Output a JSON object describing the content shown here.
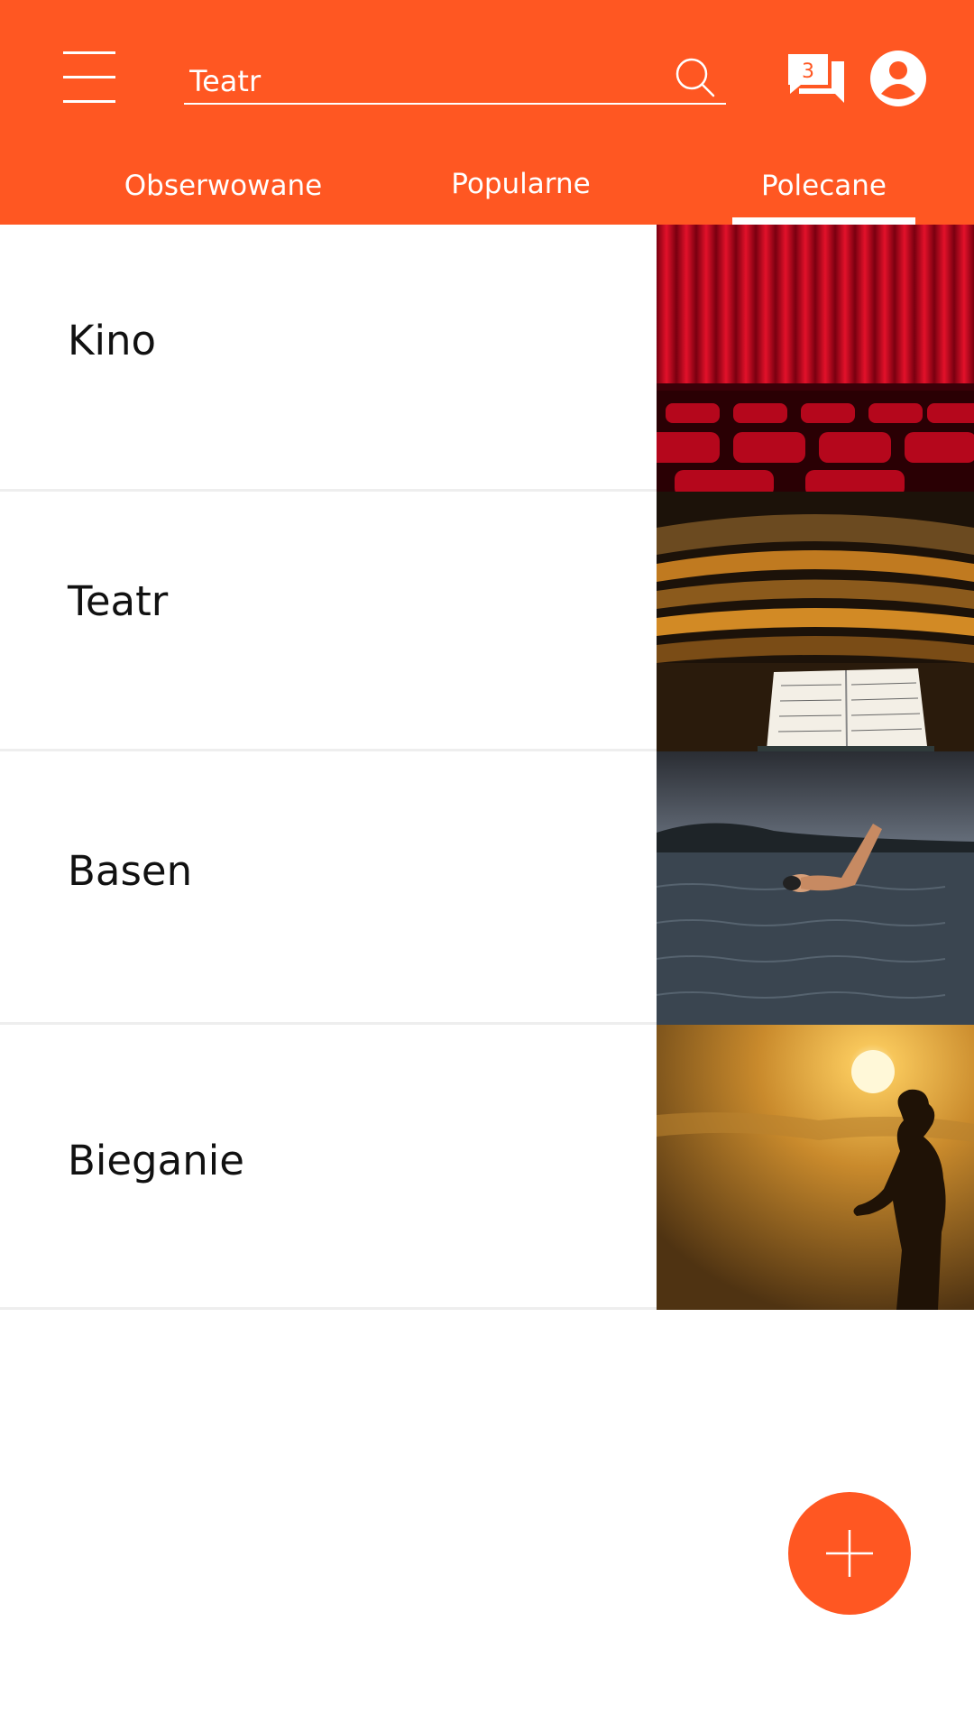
{
  "colors": {
    "accent": "#FF5722",
    "text": "#111111",
    "divider": "#eeeeee"
  },
  "header": {
    "menu_icon": "hamburger-menu-icon",
    "search": {
      "value": "Teatr",
      "placeholder": "",
      "icon": "search-icon"
    },
    "messages": {
      "icon": "chat-icon",
      "badge": "3"
    },
    "profile_icon": "avatar-icon"
  },
  "tabs": [
    {
      "label": "Obserwowane",
      "active": false
    },
    {
      "label": "Popularne",
      "active": false
    },
    {
      "label": "Polecane",
      "active": true
    }
  ],
  "items": [
    {
      "label": "Kino",
      "image": "theater-curtain-seats"
    },
    {
      "label": "Teatr",
      "image": "concert-hall-sheet-music"
    },
    {
      "label": "Basen",
      "image": "swimmer-in-water"
    },
    {
      "label": "Bieganie",
      "image": "runner-silhouette-sunset"
    }
  ],
  "fab": {
    "icon": "plus-icon"
  }
}
